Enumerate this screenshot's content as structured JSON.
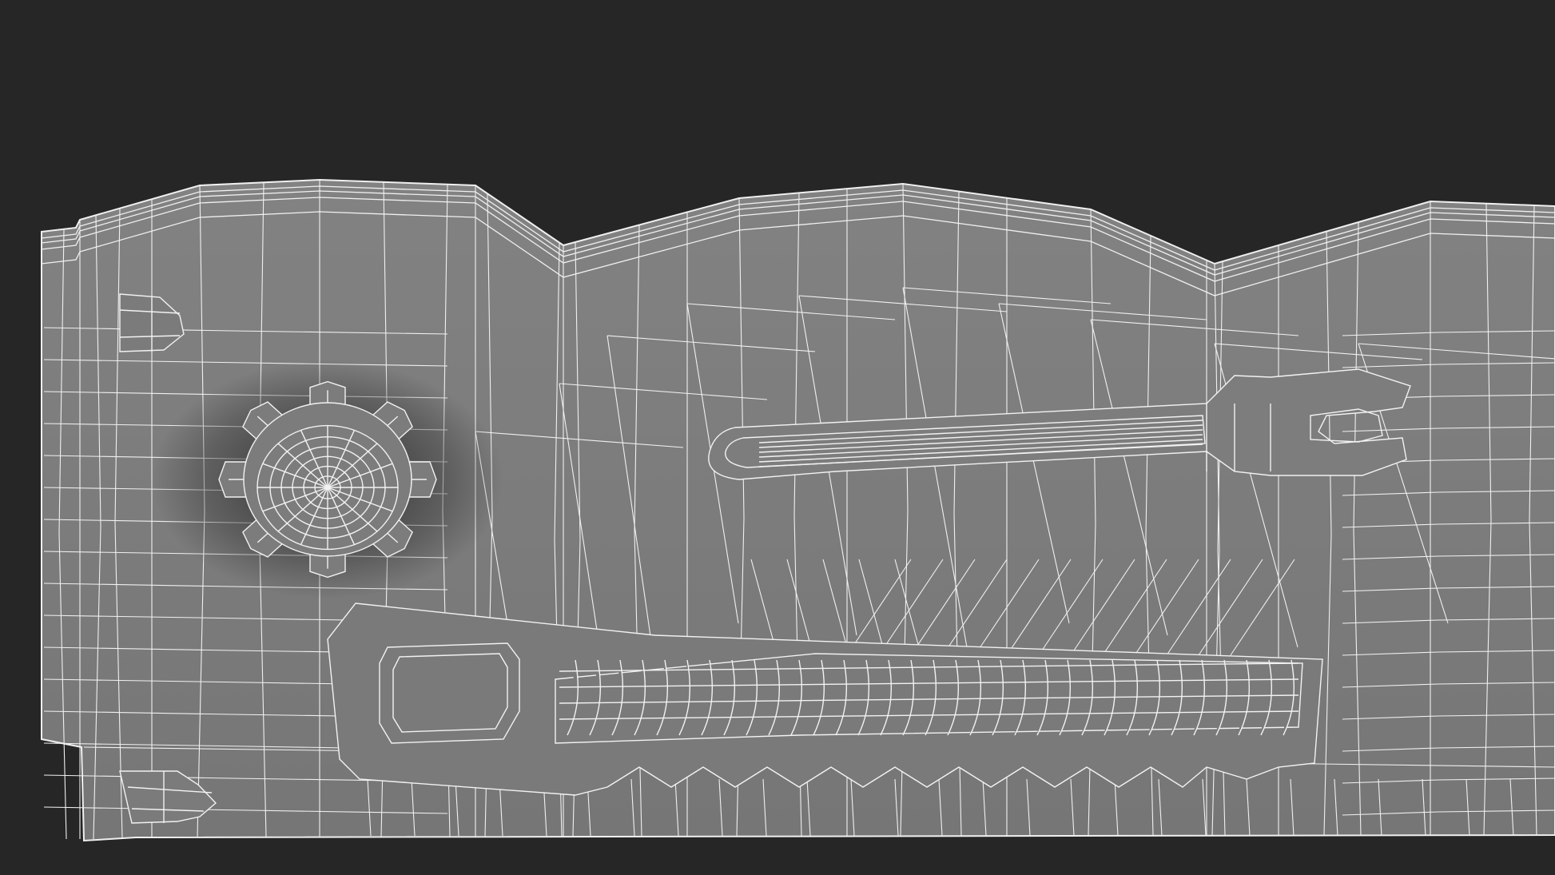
{
  "scene": {
    "colors": {
      "background": "#262626",
      "surface": "#7a7a7a",
      "surface_dark": "#6e6e6e",
      "wire": "#f2f2f2",
      "shadow": "#1e1e1e"
    },
    "render_style": "wireframe-on-shaded",
    "objects": [
      "toolbox-panel",
      "gear-relief",
      "wrench-relief",
      "saw-relief",
      "left-hinge-top",
      "left-hinge-bottom"
    ]
  }
}
